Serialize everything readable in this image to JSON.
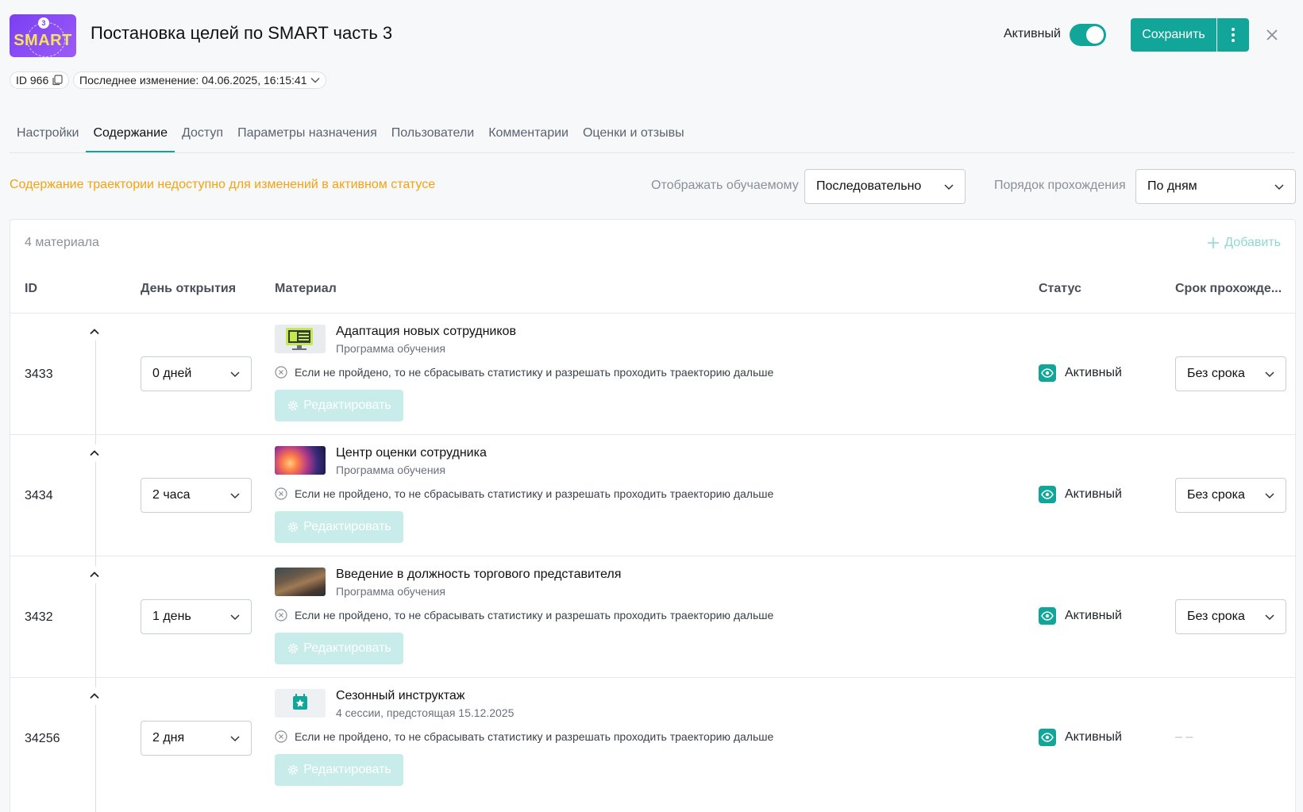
{
  "header": {
    "logo_text": "SMART",
    "logo_badge": "3",
    "title": "Постановка целей по SMART часть 3",
    "active_label": "Активный",
    "active_toggle": true,
    "save_label": "Сохранить",
    "id_chip": "ID 966",
    "last_change": "Последнее изменение: 04.06.2025, 16:15:41"
  },
  "tabs": [
    {
      "label": "Настройки",
      "active": false
    },
    {
      "label": "Содержание",
      "active": true
    },
    {
      "label": "Доступ",
      "active": false
    },
    {
      "label": "Параметры назначения",
      "active": false
    },
    {
      "label": "Пользователи",
      "active": false
    },
    {
      "label": "Комментарии",
      "active": false
    },
    {
      "label": "Оценки и отзывы",
      "active": false
    }
  ],
  "content": {
    "warning": "Содержание траектории недоступно для изменений в активном статусе",
    "display_label": "Отображать обучаемому",
    "display_value": "Последовательно",
    "order_label": "Порядок прохождения",
    "order_value": "По дням",
    "count": "4 материала",
    "add_label": "Добавить"
  },
  "table": {
    "columns": [
      "ID",
      "День открытия",
      "Материал",
      "Статус",
      "Срок прохожде..."
    ],
    "rows": [
      {
        "id": "3433",
        "day": "0 дней",
        "title": "Адаптация новых сотрудников",
        "subtitle": "Программа обучения",
        "condition": "Если не пройдено, то не сбрасывать статистику и разрешать проходить траекторию дальше",
        "edit": "Редактировать",
        "status": "Активный",
        "deadline": "Без срока",
        "thumb": "monitor-icon"
      },
      {
        "id": "3434",
        "day": "2 часа",
        "title": "Центр оценки сотрудника",
        "subtitle": "Программа обучения",
        "condition": "Если не пройдено, то не сбрасывать статистику и разрешать проходить траекторию дальше",
        "edit": "Редактировать",
        "status": "Активный",
        "deadline": "Без срока",
        "thumb": "space-image"
      },
      {
        "id": "3432",
        "day": "1 день",
        "title": "Введение в должность торгового представителя",
        "subtitle": "Программа обучения",
        "condition": "Если не пройдено, то не сбрасывать статистику и разрешать проходить траекторию дальше",
        "edit": "Редактировать",
        "status": "Активный",
        "deadline": "Без срока",
        "thumb": "meeting-image"
      },
      {
        "id": "34256",
        "day": "2 дня",
        "title": "Сезонный инструктаж",
        "subtitle": "4 сессии, предстоящая 15.12.2025",
        "condition": "Если не пройдено, то не сбрасывать статистику и разрешать проходить траекторию дальше",
        "edit": "Редактировать",
        "status": "Активный",
        "deadline": "– –",
        "thumb": "calendar-icon"
      }
    ]
  },
  "colors": {
    "accent": "#12a69b",
    "warning": "#f5a20f",
    "logo_bg": "#7b3ff2"
  }
}
